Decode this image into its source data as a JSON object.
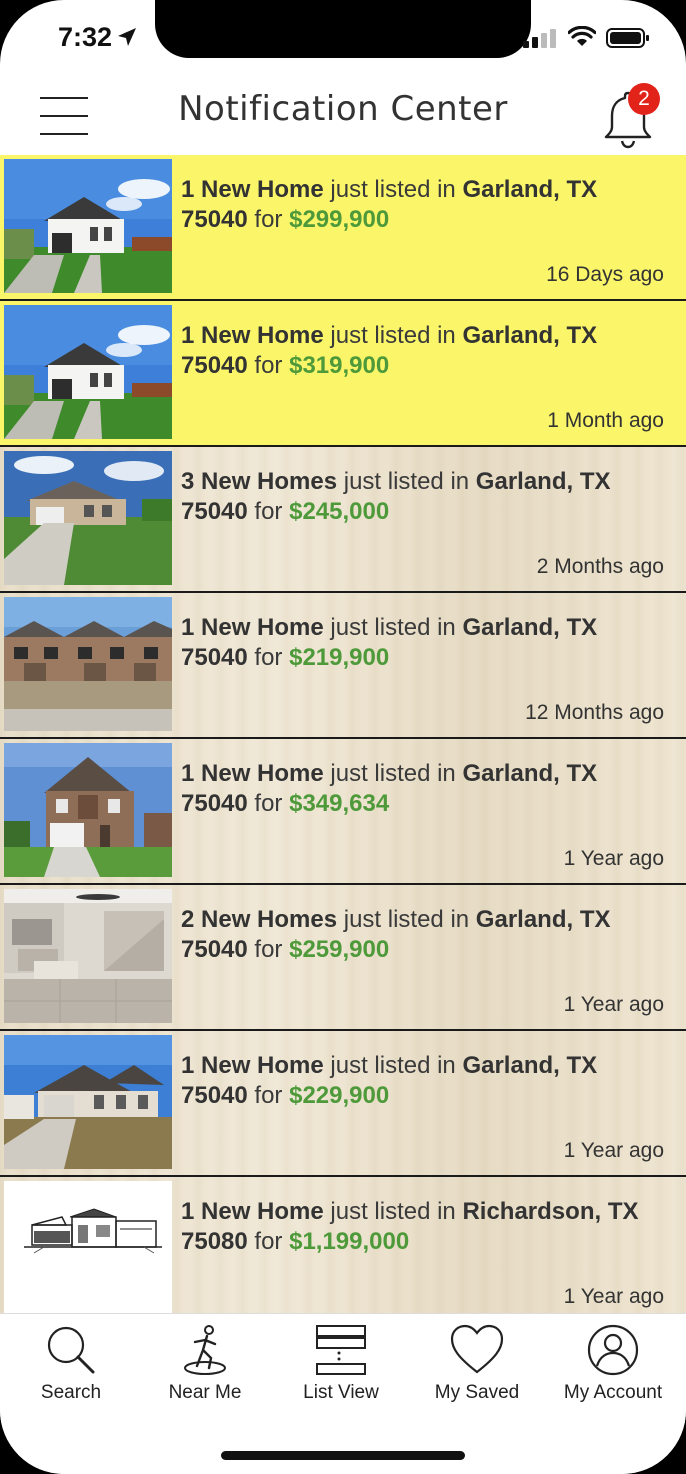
{
  "status": {
    "time": "7:32"
  },
  "header": {
    "title": "Notification Center",
    "badge_count": "2"
  },
  "notifications": [
    {
      "count": "1 New Home",
      "mid": " just listed in ",
      "city": "Garland, TX",
      "zip": "75040",
      "for": " for ",
      "price": "$299,900",
      "ago": "16 Days ago",
      "unread": true,
      "photo": "house-white"
    },
    {
      "count": "1 New Home",
      "mid": " just listed in ",
      "city": "Garland, TX",
      "zip": "75040",
      "for": " for ",
      "price": "$319,900",
      "ago": "1 Month ago",
      "unread": true,
      "photo": "house-white"
    },
    {
      "count": "3 New Homes",
      "mid": " just listed in ",
      "city": "Garland, TX",
      "zip": "75040",
      "for": " for ",
      "price": "$245,000",
      "ago": "2 Months ago",
      "unread": false,
      "photo": "house-tan"
    },
    {
      "count": "1 New Home",
      "mid": " just listed in ",
      "city": "Garland, TX",
      "zip": "75040",
      "for": " for ",
      "price": "$219,900",
      "ago": "12 Months ago",
      "unread": false,
      "photo": "townhomes"
    },
    {
      "count": "1 New Home",
      "mid": " just listed in ",
      "city": "Garland, TX",
      "zip": "75040",
      "for": " for ",
      "price": "$349,634",
      "ago": "1 Year ago",
      "unread": false,
      "photo": "house-brick"
    },
    {
      "count": "2 New Homes",
      "mid": " just listed in ",
      "city": "Garland, TX",
      "zip": "75040",
      "for": " for ",
      "price": "$259,900",
      "ago": "1 Year ago",
      "unread": false,
      "photo": "interior"
    },
    {
      "count": "1 New Home",
      "mid": " just listed in ",
      "city": "Garland, TX",
      "zip": "75040",
      "for": " for ",
      "price": "$229,900",
      "ago": "1 Year ago",
      "unread": false,
      "photo": "house-stone"
    },
    {
      "count": "1 New Home",
      "mid": " just listed in ",
      "city": "Richardson, TX",
      "zip": "75080",
      "for": " for ",
      "price": "$1,199,000",
      "ago": "1 Year ago",
      "unread": false,
      "photo": "sketch"
    }
  ],
  "tabs": [
    {
      "label": "Search",
      "icon": "search-icon"
    },
    {
      "label": "Near Me",
      "icon": "near-me-icon"
    },
    {
      "label": "List View",
      "icon": "list-view-icon"
    },
    {
      "label": "My Saved",
      "icon": "heart-icon"
    },
    {
      "label": "My Account",
      "icon": "account-icon"
    }
  ],
  "colors": {
    "unread_bg": "#fbf56a",
    "price": "#4e9a3a",
    "badge": "#e2231a"
  }
}
